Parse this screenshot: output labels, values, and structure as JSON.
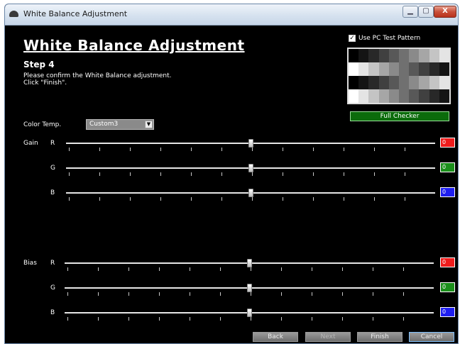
{
  "window": {
    "title": "White Balance Adjustment",
    "minimize_glyph": "▁",
    "maximize_glyph": "▢",
    "close_glyph": "X"
  },
  "page": {
    "title": "White Balance Adjustment",
    "step": "Step 4",
    "instructions": "Please confirm the White Balance adjustment.\nClick \"Finish\"."
  },
  "test_pattern": {
    "checkbox_label": "Use PC Test Pattern",
    "checked": true,
    "check_glyph": "✓",
    "full_checker_label": "Full Checker"
  },
  "color_temp": {
    "label": "Color Temp.",
    "value": "Custom3",
    "arrow_glyph": "▼"
  },
  "gain": {
    "label": "Gain",
    "channels": [
      {
        "name": "R",
        "value": "0",
        "level": 0.5
      },
      {
        "name": "G",
        "value": "0",
        "level": 0.5
      },
      {
        "name": "B",
        "value": "0",
        "level": 0.5
      }
    ]
  },
  "bias": {
    "label": "Bias",
    "channels": [
      {
        "name": "R",
        "value": "0",
        "level": 0.5
      },
      {
        "name": "G",
        "value": "0",
        "level": 0.5
      },
      {
        "name": "B",
        "value": "0",
        "level": 0.5
      }
    ]
  },
  "buttons": {
    "back": "Back",
    "next": "Next",
    "finish": "Finish",
    "cancel": "Cancel"
  },
  "colors": {
    "red": "#ee1c1c",
    "green": "#1a8f1a",
    "blue": "#1e1ef0",
    "accent_green": "#0b6b0b"
  }
}
